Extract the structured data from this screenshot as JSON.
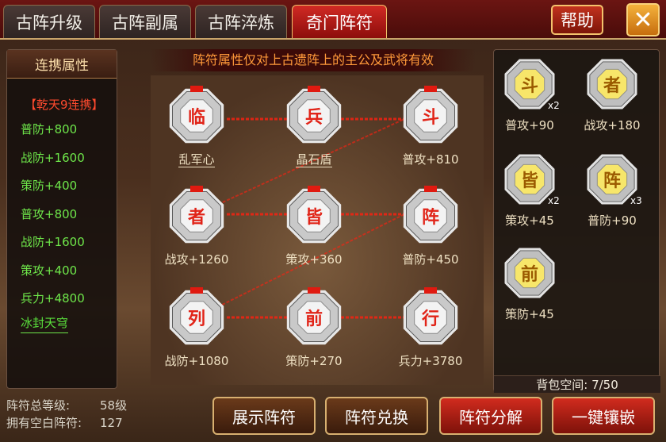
{
  "tabs": [
    {
      "label": "古阵升级",
      "active": false
    },
    {
      "label": "古阵副属",
      "active": false
    },
    {
      "label": "古阵淬炼",
      "active": false
    },
    {
      "label": "奇门阵符",
      "active": true
    }
  ],
  "header": {
    "help_label": "帮助",
    "close_icon": "close-icon"
  },
  "combo_panel": {
    "title": "连携属性",
    "set_name": "【乾天9连携】",
    "attributes": [
      "普防+800",
      "战防+1600",
      "策防+400",
      "普攻+800",
      "战防+1600",
      "策攻+400",
      "兵力+4800"
    ],
    "skill": "冰封天穹"
  },
  "summary": {
    "level_label": "阵符总等级:",
    "level_value": "58级",
    "blank_label": "拥有空白阵符:",
    "blank_value": "127"
  },
  "notice": "阵符属性仅对上古遗阵上的主公及武将有效",
  "slots": [
    {
      "glyph": "临",
      "name": "乱军心",
      "underline": true
    },
    {
      "glyph": "兵",
      "name": "晶石盾",
      "underline": true
    },
    {
      "glyph": "斗",
      "name": "普攻+810",
      "underline": false
    },
    {
      "glyph": "者",
      "name": "战攻+1260",
      "underline": false
    },
    {
      "glyph": "皆",
      "name": "策攻+360",
      "underline": false
    },
    {
      "glyph": "阵",
      "name": "普防+450",
      "underline": false
    },
    {
      "glyph": "列",
      "name": "战防+1080",
      "underline": false
    },
    {
      "glyph": "前",
      "name": "策防+270",
      "underline": false
    },
    {
      "glyph": "行",
      "name": "兵力+3780",
      "underline": false
    }
  ],
  "inventory": {
    "items": [
      {
        "glyph": "斗",
        "count": "x2",
        "label": "普攻+90"
      },
      {
        "glyph": "者",
        "count": "",
        "label": "战攻+180"
      },
      {
        "glyph": "皆",
        "count": "x2",
        "label": "策攻+45"
      },
      {
        "glyph": "阵",
        "count": "x3",
        "label": "普防+90"
      },
      {
        "glyph": "前",
        "count": "",
        "label": "策防+45"
      }
    ],
    "bag_label": "背包空间:",
    "bag_value": "7/50"
  },
  "buttons": {
    "show": "展示阵符",
    "exchange": "阵符兑换",
    "decompose": "阵符分解",
    "embed": "一键镶嵌"
  },
  "colors": {
    "accent_red": "#d12a24",
    "gold": "#f0c36a",
    "glyph_red": "#e12418",
    "green": "#6ee64a"
  }
}
